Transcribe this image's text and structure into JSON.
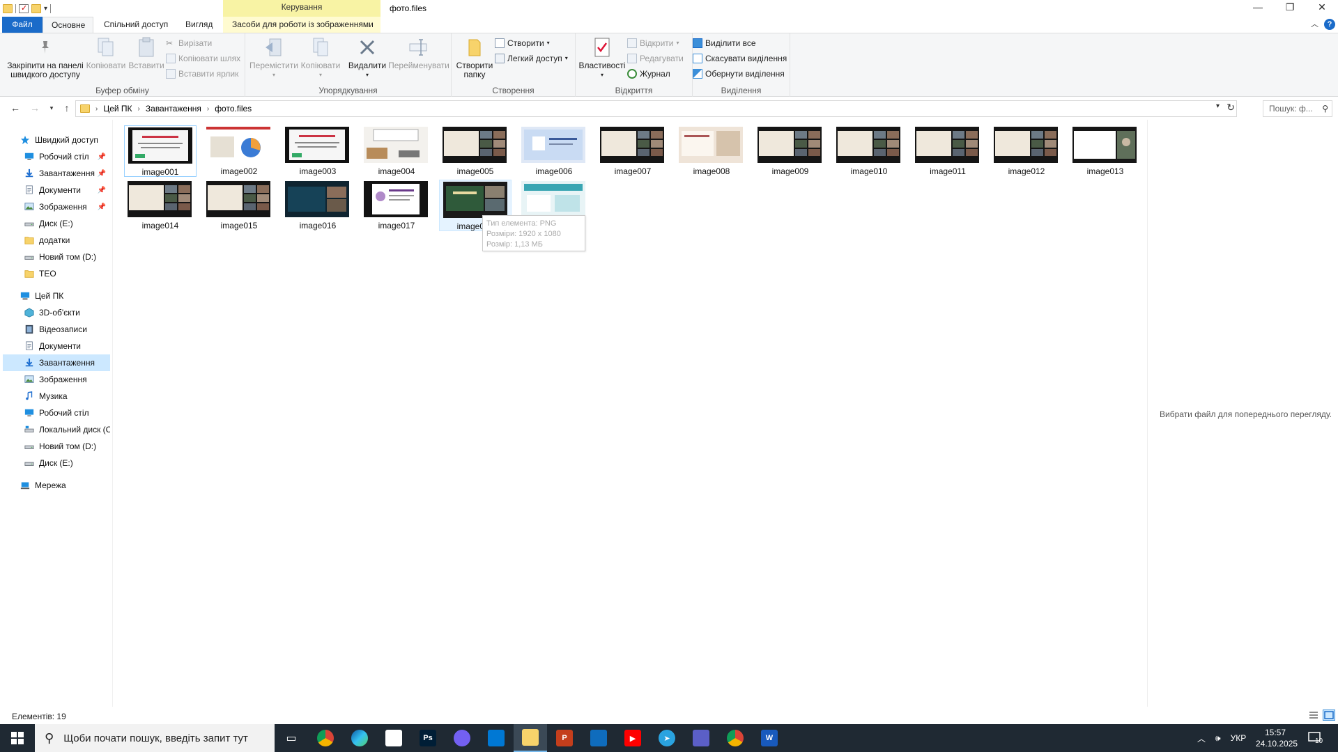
{
  "window": {
    "title": "фото.files",
    "context_tab_header": "Керування",
    "controls": [
      "—",
      "❐",
      "✕"
    ]
  },
  "ribbon_tabs": [
    {
      "label": "Файл"
    },
    {
      "label": "Основне"
    },
    {
      "label": "Спільний доступ"
    },
    {
      "label": "Вигляд"
    },
    {
      "label": "Засоби для роботи із зображеннями"
    }
  ],
  "ribbon": {
    "clipboard": {
      "label": "Буфер обміну",
      "pin_quick_access": "Закріпити на панелі швидкого доступу",
      "pin_line1": "Закріпити на панелі",
      "pin_line2": "швидкого доступу",
      "copy": "Копіювати",
      "paste": "Вставити",
      "cut": "Вирізати",
      "copy_path": "Копіювати шлях",
      "paste_shortcut": "Вставити ярлик"
    },
    "organize": {
      "label": "Упорядкування",
      "move_to": "Перемістити",
      "copy_to": "Копіювати",
      "delete": "Видалити",
      "rename": "Перейменувати"
    },
    "create": {
      "label": "Створення",
      "new_folder_line1": "Створити",
      "new_folder_line2": "папку",
      "new_item": "Створити",
      "easy_access": "Легкий доступ"
    },
    "open": {
      "label": "Відкриття",
      "properties": "Властивості",
      "open": "Відкрити",
      "edit": "Редагувати",
      "history": "Журнал"
    },
    "select": {
      "label": "Виділення",
      "select_all": "Виділити все",
      "select_none": "Скасувати виділення",
      "invert": "Обернути виділення"
    }
  },
  "address": {
    "crumbs": [
      "Цей ПК",
      "Завантаження",
      "фото.files"
    ],
    "search_placeholder": "Пошук: ф..."
  },
  "nav": {
    "quick_access": "Швидкий доступ",
    "quick_items": [
      {
        "label": "Робочий стіл",
        "icon": "desktop-icon",
        "pinned": true
      },
      {
        "label": "Завантаження",
        "icon": "download-icon",
        "pinned": true
      },
      {
        "label": "Документи",
        "icon": "documents-icon",
        "pinned": true
      },
      {
        "label": "Зображення",
        "icon": "pictures-icon",
        "pinned": true
      },
      {
        "label": "Диск (E:)",
        "icon": "drive-icon",
        "pinned": false
      },
      {
        "label": "додатки",
        "icon": "folder-icon",
        "pinned": false
      },
      {
        "label": "Новий том (D:)",
        "icon": "drive-icon",
        "pinned": false
      },
      {
        "label": "ТЕО",
        "icon": "folder-icon",
        "pinned": false
      }
    ],
    "this_pc": "Цей ПК",
    "pc_items": [
      {
        "label": "3D-об'єкти",
        "icon": "3d-objects-icon"
      },
      {
        "label": "Відеозаписи",
        "icon": "videos-icon"
      },
      {
        "label": "Документи",
        "icon": "documents-icon"
      },
      {
        "label": "Завантаження",
        "icon": "download-icon",
        "selected": true
      },
      {
        "label": "Зображення",
        "icon": "pictures-icon"
      },
      {
        "label": "Музика",
        "icon": "music-icon"
      },
      {
        "label": "Робочий стіл",
        "icon": "desktop-icon"
      },
      {
        "label": "Локальний диск (C",
        "icon": "system-drive-icon"
      },
      {
        "label": "Новий том (D:)",
        "icon": "drive-icon"
      },
      {
        "label": "Диск (E:)",
        "icon": "drive-icon"
      }
    ],
    "network": "Мережа"
  },
  "files": [
    {
      "name": "image001",
      "style": "white-slide"
    },
    {
      "name": "image002",
      "style": "chart-slide"
    },
    {
      "name": "image003",
      "style": "white-slide"
    },
    {
      "name": "image004",
      "style": "book-slide"
    },
    {
      "name": "image005",
      "style": "grid-call"
    },
    {
      "name": "image006",
      "style": "blue-slide"
    },
    {
      "name": "image007",
      "style": "grid-call"
    },
    {
      "name": "image008",
      "style": "beige-slide"
    },
    {
      "name": "image009",
      "style": "grid-call"
    },
    {
      "name": "image010",
      "style": "grid-call"
    },
    {
      "name": "image011",
      "style": "grid-call"
    },
    {
      "name": "image012",
      "style": "grid-call"
    },
    {
      "name": "image013",
      "style": "single-call"
    },
    {
      "name": "image014",
      "style": "grid-call"
    },
    {
      "name": "image015",
      "style": "grid-call"
    },
    {
      "name": "image016",
      "style": "dark-slide"
    },
    {
      "name": "image017",
      "style": "purple-slide"
    },
    {
      "name": "image018",
      "style": "green-slide"
    },
    {
      "name": "image019",
      "style": "teal-slide"
    }
  ],
  "tooltip": {
    "line1": "Тип елемента: PNG",
    "line2": "Розміри: 1920 x 1080",
    "line3": "Розмір: 1,13 МБ"
  },
  "preview_text": "Вибрати файл для попереднього перегляду.",
  "status": {
    "count_text": "Елементів: 19"
  },
  "taskbar": {
    "search_placeholder": "Щоби почати пошук, введіть запит тут",
    "apps": [
      {
        "name": "task-view"
      },
      {
        "name": "chrome"
      },
      {
        "name": "edge"
      },
      {
        "name": "notepad"
      },
      {
        "name": "photoshop",
        "label": "Ps"
      },
      {
        "name": "viber"
      },
      {
        "name": "store"
      },
      {
        "name": "file-explorer",
        "active": true
      },
      {
        "name": "powerpoint",
        "label": "P"
      },
      {
        "name": "outlook"
      },
      {
        "name": "youtube"
      },
      {
        "name": "telegram"
      },
      {
        "name": "app-shield"
      },
      {
        "name": "chrome-2"
      },
      {
        "name": "word",
        "label": "W"
      }
    ],
    "language": "УКР",
    "time": "15:57",
    "date": "24.10.2025",
    "notifications": "10"
  },
  "colors": {
    "accent": "#1a6bc9",
    "selection": "#cce8ff",
    "context_tab": "#f8f3a4",
    "taskbar": "#1f2933"
  }
}
